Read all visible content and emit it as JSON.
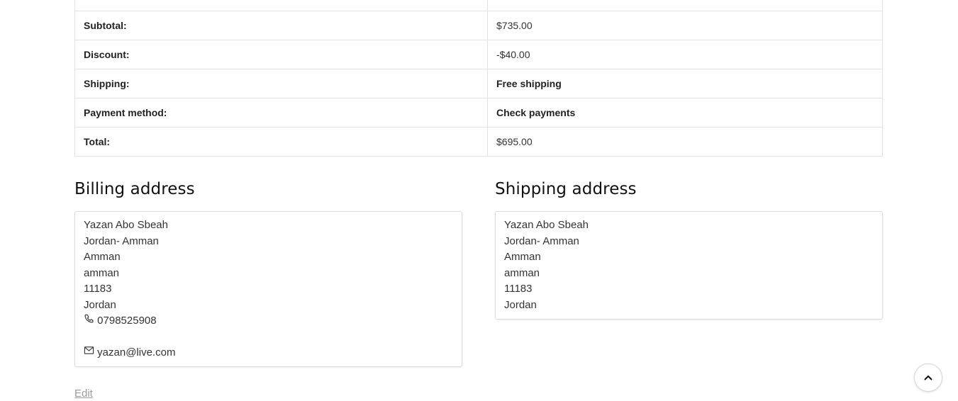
{
  "order_totals": {
    "rows": [
      {
        "label": "",
        "value": "",
        "strong": false
      },
      {
        "label": "Subtotal:",
        "value": "$735.00",
        "strong": false
      },
      {
        "label": "Discount:",
        "value": "-$40.00",
        "strong": false
      },
      {
        "label": "Shipping:",
        "value": "Free shipping",
        "strong": true
      },
      {
        "label": "Payment method:",
        "value": "Check payments",
        "strong": true
      },
      {
        "label": "Total:",
        "value": "$695.00",
        "strong": false
      }
    ]
  },
  "billing": {
    "title": "Billing address",
    "name": "Yazan Abo Sbeah",
    "address_1": "Jordan- Amman",
    "city": "Amman",
    "state": "amman",
    "postcode": "11183",
    "country": "Jordan",
    "phone": "0798525908",
    "email": "yazan@live.com",
    "phone_icon": "phone-icon",
    "email_icon": "envelope-icon"
  },
  "shipping": {
    "title": "Shipping address",
    "name": "Yazan Abo Sbeah",
    "address_1": "Jordan- Amman",
    "city": "Amman",
    "state": "amman",
    "postcode": "11183",
    "country": "Jordan"
  },
  "edit_label": "Edit",
  "scroll_top_icon": "chevron-up-icon"
}
